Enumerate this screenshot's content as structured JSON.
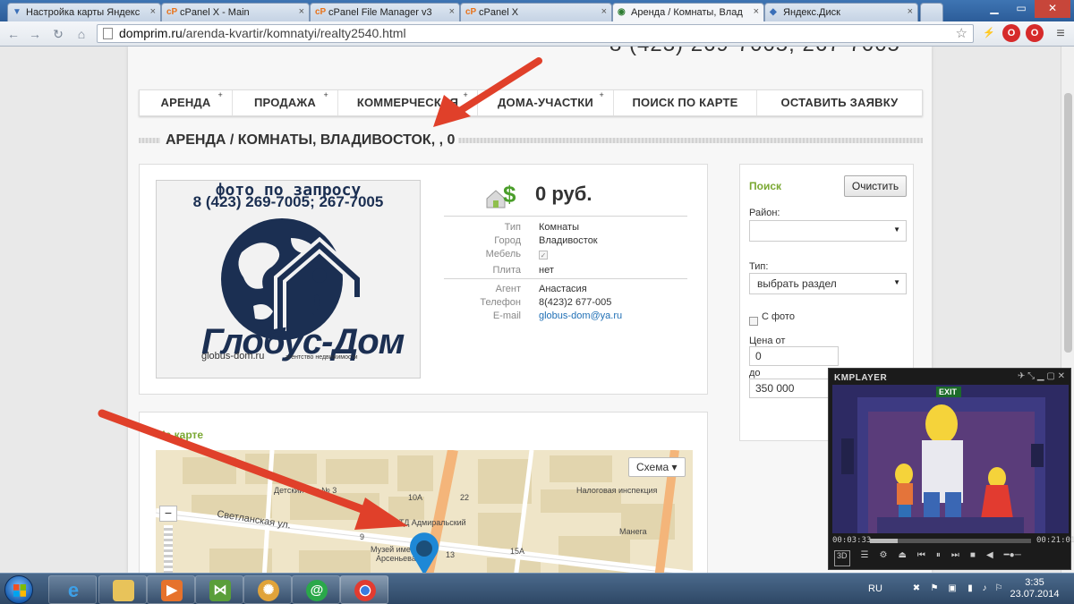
{
  "browser": {
    "tabs": [
      {
        "label": "Настройка карты Яндекс",
        "icon": "yandex-map-icon",
        "active": false
      },
      {
        "label": "cPanel X - Main",
        "icon": "cpanel-icon",
        "active": false
      },
      {
        "label": "cPanel File Manager v3",
        "icon": "cpanel-icon",
        "active": false
      },
      {
        "label": "cPanel X",
        "icon": "cpanel-icon",
        "active": false
      },
      {
        "label": "Аренда / Комнаты, Влад",
        "icon": "site-icon",
        "active": true
      },
      {
        "label": "Яндекс.Диск",
        "icon": "disk-icon",
        "active": false
      }
    ],
    "url_host": "domprim.ru",
    "url_path": "/arenda-kvartir/komnatyi/realty2540.html"
  },
  "site": {
    "header_phones": "8 (423) 269-7005; 267-7005",
    "nav": [
      {
        "label": "АРЕНДА",
        "plus": "+"
      },
      {
        "label": "ПРОДАЖА",
        "plus": "+"
      },
      {
        "label": "КОММЕРЧЕСКАЯ",
        "plus": "+"
      },
      {
        "label": "ДОМА-УЧАСТКИ",
        "plus": "+"
      },
      {
        "label": "ПОИСК ПО КАРТЕ",
        "plus": ""
      },
      {
        "label": "ОСТАВИТЬ ЗАЯВКУ",
        "plus": ""
      }
    ],
    "page_title": "АРЕНДА / КОМНАТЫ, ВЛАДИВОСТОК, , 0"
  },
  "listing": {
    "photo_caption_line1": "фото по запросу",
    "photo_caption_line2": "8 (423) 269-7005; 267-7005",
    "logo_text": "Глобус-Дом",
    "logo_site": "globus-dom.ru",
    "logo_tagline": "агентство недвижимости",
    "price": "0 руб.",
    "props": {
      "type_label": "Тип",
      "type_value": "Комнаты",
      "city_label": "Город",
      "city_value": "Владивосток",
      "furniture_label": "Мебель",
      "stove_label": "Плита",
      "stove_value": "нет",
      "agent_label": "Агент",
      "agent_value": "Анастасия",
      "phone_label": "Телефон",
      "phone_value": "8(423)2 677-005",
      "email_label": "E-mail",
      "email_value": "globus-dom@ya.ru"
    }
  },
  "map": {
    "heading": "На карте",
    "schema_button": "Схема",
    "labels": {
      "kindergarten": "Детский сад № 3",
      "tax": "Налоговая инспекция",
      "street": "Светланская ул.",
      "td": "ТД Адмиральский",
      "museum1": "Музей имени",
      "museum2": "Арсеньева",
      "manega": "Манега",
      "n10a": "10А",
      "n22": "22",
      "n9": "9",
      "n13": "13",
      "n15a": "15А"
    }
  },
  "search": {
    "title": "Поиск",
    "clear_button": "Очистить",
    "district_label": "Район:",
    "district_value": "",
    "type_label": "Тип:",
    "type_value": "выбрать раздел",
    "photo_label": "С фото",
    "price_from_label": "Цена от",
    "price_from_value": "0",
    "price_to_label": "до",
    "price_to_value": "350 000"
  },
  "kmplayer": {
    "title": "KMPLAYER",
    "exit_sign": "EXIT",
    "time_current": "00:03:33",
    "time_total": "00:21:01",
    "progress": 0.17,
    "badge_3d": "3D"
  },
  "taskbar": {
    "lang": "RU",
    "time": "3:35",
    "date": "23.07.2014"
  },
  "colors": {
    "accent_green": "#7aa832",
    "link_blue": "#1f6fb5",
    "logo_navy": "#1b2f52",
    "arrow_red": "#e0402a"
  }
}
